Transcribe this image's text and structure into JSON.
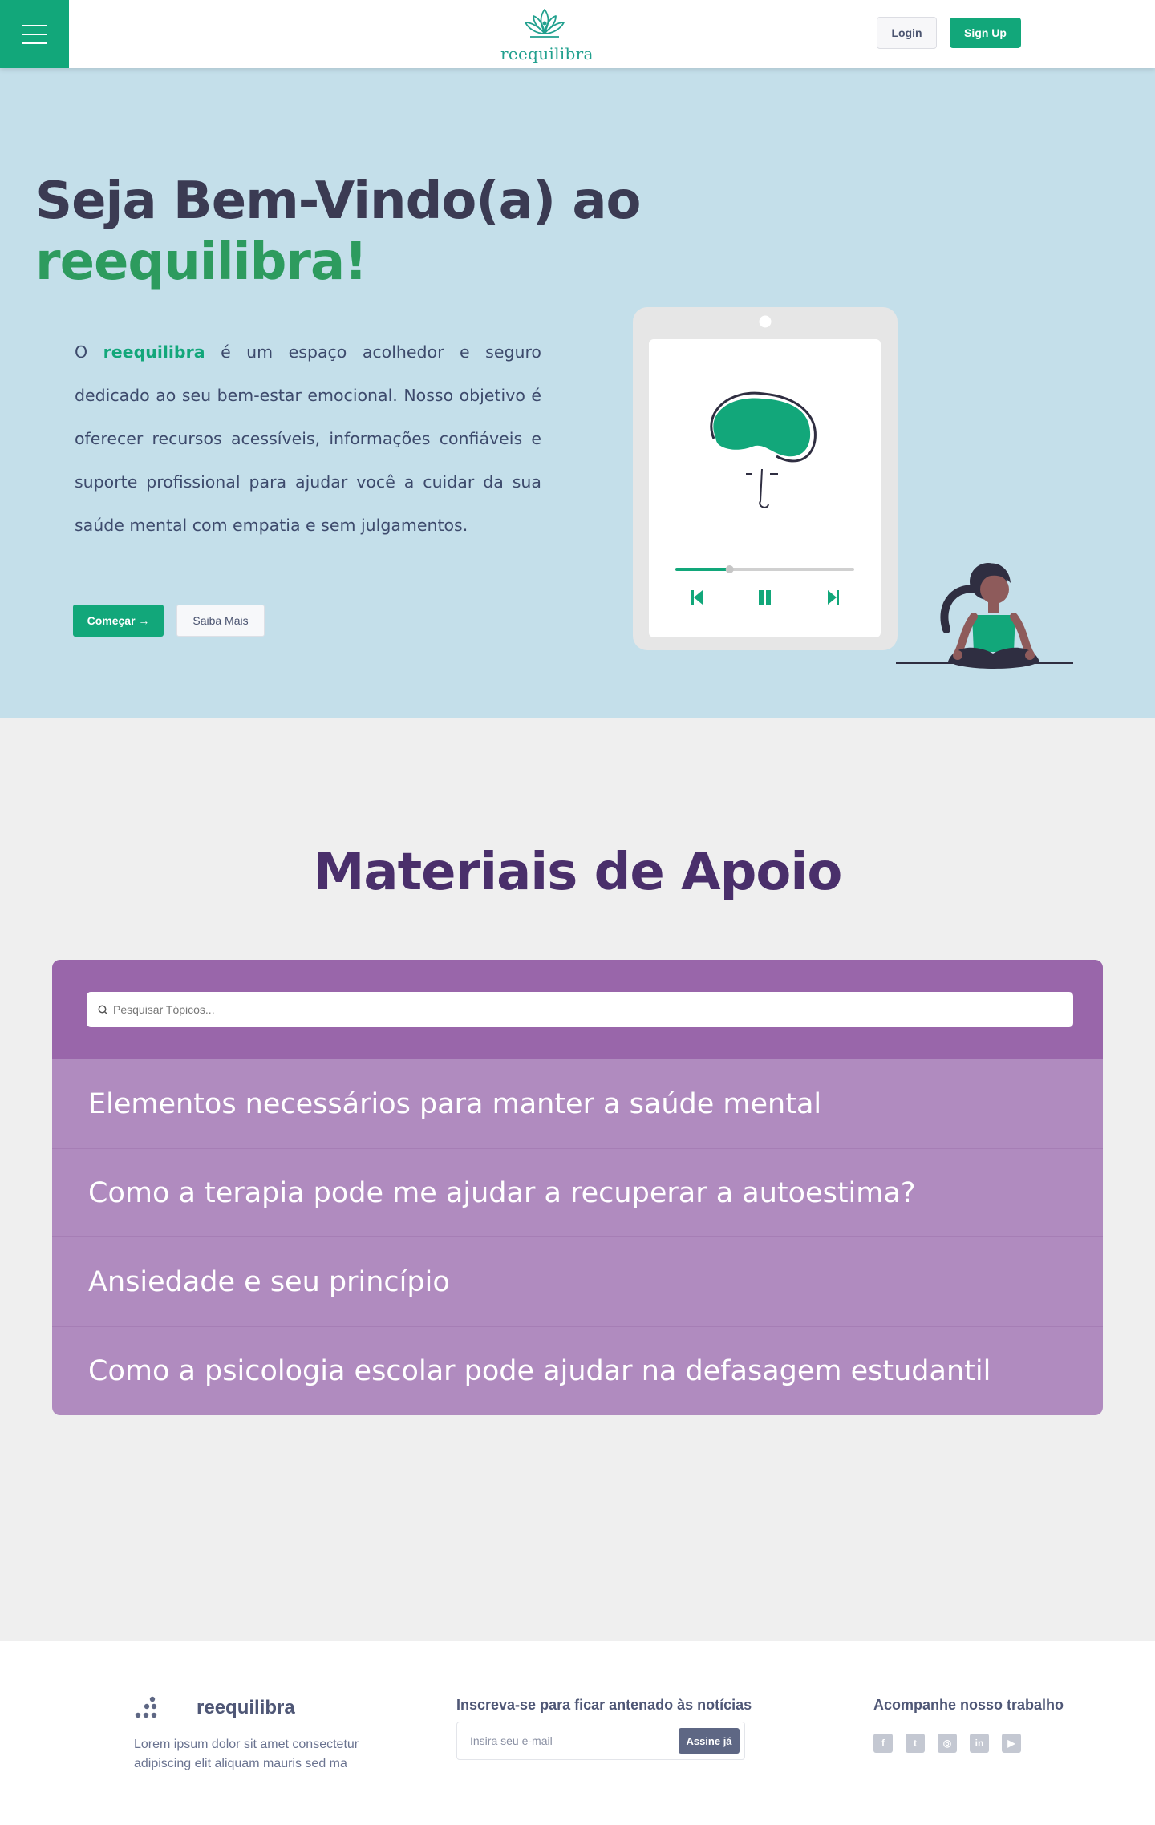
{
  "header": {
    "brand": "reequilibra",
    "login_label": "Login",
    "signup_label": "Sign Up"
  },
  "hero": {
    "title_line1": "Seja Bem-Vindo(a) ao",
    "title_brand": "reequilibra!",
    "intro_prefix": "O",
    "intro_brand": "reequilibra",
    "intro_text": "é um espaço acolhedor e seguro dedicado ao seu bem-estar emocional. Nosso objetivo é oferecer recursos acessíveis, informações confiáveis e suporte profissional para ajudar você a cuidar da sua saúde mental com empatia e sem julgamentos.",
    "start_label": "Começar →",
    "more_label": "Saiba Mais",
    "player_progress": 0.3
  },
  "materials": {
    "title": "Materiais de Apoio",
    "search_placeholder": "Pesquisar Tópicos...",
    "topics": [
      "Elementos necessários para manter a saúde mental",
      "Como a terapia pode me ajudar a recuperar a autoestima?",
      "Ansiedade e seu princípio",
      "Como a psicologia escolar pode ajudar na defasagem estudantil"
    ]
  },
  "footer": {
    "brand": "reequilibra",
    "description": "Lorem ipsum dolor sit amet consectetur adipiscing elit aliquam mauris sed ma",
    "newsletter_title": "Inscreva-se para ficar antenado às notícias",
    "email_placeholder": "Insira seu e-mail",
    "submit_label": "Assine já",
    "follow_title": "Acompanhe nosso trabalho",
    "socials": [
      {
        "icon": "facebook-icon",
        "glyph": "f"
      },
      {
        "icon": "twitter-icon",
        "glyph": "t"
      },
      {
        "icon": "instagram-icon",
        "glyph": "◎"
      },
      {
        "icon": "linkedin-icon",
        "glyph": "in"
      },
      {
        "icon": "youtube-icon",
        "glyph": "▶"
      }
    ]
  },
  "colors": {
    "primary": "#12a77a",
    "hero_bg": "#c4dfea",
    "purple_dark": "#9966aa",
    "purple_light": "#b08bbf",
    "title_purple": "#4a2f6b"
  }
}
